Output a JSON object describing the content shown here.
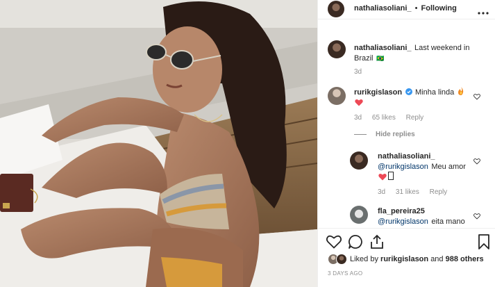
{
  "header": {
    "username": "nathaliasoliani_",
    "separator": "•",
    "follow_status": "Following",
    "more_icon": "more-horizontal-icon"
  },
  "caption": {
    "username": "nathaliasoliani_",
    "text": "Last weekend in Brazil",
    "flag": "🇧🇷",
    "age": "3d"
  },
  "comments": [
    {
      "username": "rurikgislason",
      "verified": true,
      "text": "Minha linda",
      "emoji": "🔥",
      "second_line": "❤️",
      "age": "3d",
      "likes": "65 likes",
      "reply": "Reply",
      "hide_replies": "Hide replies"
    },
    {
      "username": "nathaliasoliani_",
      "mention": "@rurikgislason",
      "text": "Meu amor",
      "second_line": "❤️",
      "age": "3d",
      "likes": "31 likes",
      "reply": "Reply"
    },
    {
      "username": "fla_pereira25",
      "mention": "@rurikgislason",
      "text": "eita mano"
    }
  ],
  "footer": {
    "liked_by_prefix": "Liked by",
    "liked_by_user": "rurikgislason",
    "liked_by_and": "and",
    "liked_by_count": "988 others",
    "timestamp": "3 DAYS AGO"
  },
  "colors": {
    "red_heart": "#ed4956",
    "verified": "#3897f0",
    "link": "#003569",
    "muted": "#8e8e8e"
  }
}
